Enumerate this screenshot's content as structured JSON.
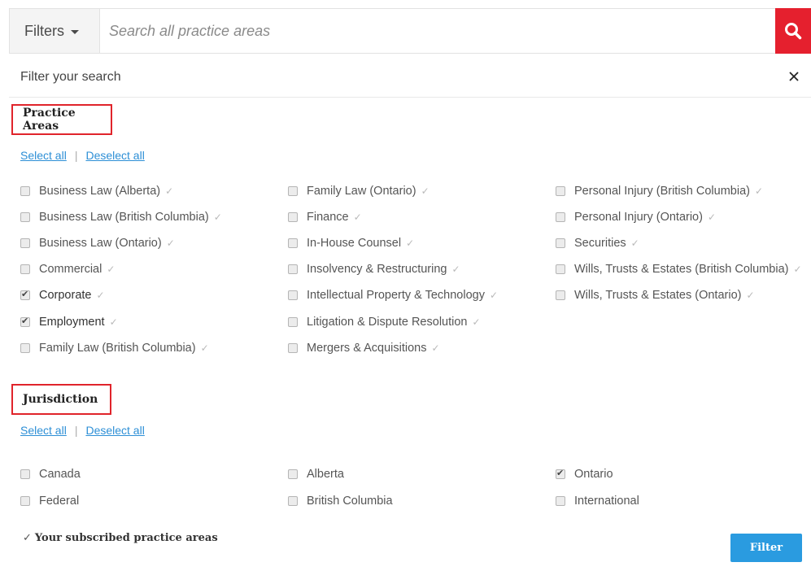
{
  "search": {
    "filters_label": "Filters",
    "placeholder": "Search all practice areas",
    "value": ""
  },
  "filter_panel": {
    "header": "Filter your search"
  },
  "practice_areas": {
    "title": "Practice Areas",
    "select_all": "Select all",
    "deselect_all": "Deselect all",
    "items": [
      {
        "label": "Business Law (Alberta)",
        "checked": false
      },
      {
        "label": "Business Law (British Columbia)",
        "checked": false
      },
      {
        "label": "Business Law (Ontario)",
        "checked": false
      },
      {
        "label": "Commercial",
        "checked": false
      },
      {
        "label": "Corporate",
        "checked": true
      },
      {
        "label": "Employment",
        "checked": true
      },
      {
        "label": "Family Law (British Columbia)",
        "checked": false
      },
      {
        "label": "Family Law (Ontario)",
        "checked": false
      },
      {
        "label": "Finance",
        "checked": false
      },
      {
        "label": "In-House Counsel",
        "checked": false
      },
      {
        "label": "Insolvency & Restructuring",
        "checked": false
      },
      {
        "label": "Intellectual Property & Technology",
        "checked": false
      },
      {
        "label": "Litigation & Dispute Resolution",
        "checked": false
      },
      {
        "label": "Mergers & Acquisitions",
        "checked": false
      },
      {
        "label": "Personal Injury (British Columbia)",
        "checked": false
      },
      {
        "label": "Personal Injury (Ontario)",
        "checked": false
      },
      {
        "label": "Securities",
        "checked": false
      },
      {
        "label": "Wills, Trusts & Estates (British Columbia)",
        "checked": false
      },
      {
        "label": "Wills, Trusts & Estates (Ontario)",
        "checked": false
      }
    ]
  },
  "jurisdiction": {
    "title": "Jurisdiction",
    "select_all": "Select all",
    "deselect_all": "Deselect all",
    "items": [
      {
        "label": "Canada",
        "checked": false
      },
      {
        "label": "Federal",
        "checked": false
      },
      {
        "label": "Alberta",
        "checked": false
      },
      {
        "label": "British Columbia",
        "checked": false
      },
      {
        "label": "Ontario",
        "checked": true
      },
      {
        "label": "International",
        "checked": false
      }
    ]
  },
  "footer": {
    "subscribed_label": "Your subscribed practice areas",
    "filter_button": "Filter"
  },
  "colors": {
    "search_button": "#e5202e",
    "highlight_border": "#e0242b",
    "link": "#2d8fd6",
    "filter_button": "#2a9be0"
  },
  "icons": {
    "search": "search-icon",
    "close": "close-icon",
    "caret": "caret-down-icon",
    "check": "check-icon"
  }
}
